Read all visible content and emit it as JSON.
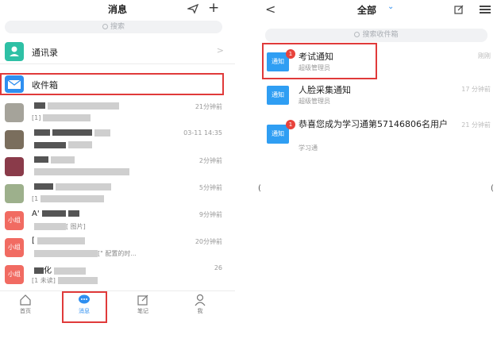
{
  "left": {
    "title": "消息",
    "search_placeholder": "搜索",
    "contacts_label": "通讯录",
    "inbox_label": "收件箱",
    "messages": [
      {
        "avatar": "",
        "name": "",
        "preview": "[1]",
        "time": "21分钟前"
      },
      {
        "avatar": "",
        "name": "",
        "preview": "",
        "time": "03-11 14:35"
      },
      {
        "avatar": "",
        "name": "",
        "preview": "",
        "time": "2分钟前"
      },
      {
        "avatar": "",
        "name": "",
        "preview": "[1",
        "time": "5分钟前"
      },
      {
        "avatar": "小组",
        "name": "A'",
        "preview": "[ 图片]",
        "time": "9分钟前"
      },
      {
        "avatar": "小组",
        "name": "[",
        "preview": "[\" 配置的时...",
        "time": "20分钟前"
      },
      {
        "avatar": "小组",
        "name": "化",
        "preview": "[1 未读]",
        "time": "26"
      }
    ],
    "tabs": [
      {
        "label": "首页",
        "icon": "home-icon"
      },
      {
        "label": "消息",
        "icon": "chat-icon"
      },
      {
        "label": "笔记",
        "icon": "note-icon"
      },
      {
        "label": "我",
        "icon": "user-icon"
      }
    ]
  },
  "right": {
    "title": "全部",
    "search_placeholder": "搜索收件箱",
    "notifications": [
      {
        "icon_text": "通知",
        "badge": "1",
        "title": "考试通知",
        "sender": "超级管理员",
        "time": "刚刚"
      },
      {
        "icon_text": "通知",
        "badge": "",
        "title": "人脸采集通知",
        "sender": "超级管理员",
        "time": "17 分钟前"
      },
      {
        "icon_text": "通知",
        "badge": "1",
        "title": "恭喜您成为学习通第57146806名用户",
        "sender": "学习通",
        "time": "21 分钟前"
      }
    ]
  },
  "colors": {
    "accent": "#2f8ff0",
    "highlight": "#e03a3a",
    "badge": "#e8433c"
  }
}
